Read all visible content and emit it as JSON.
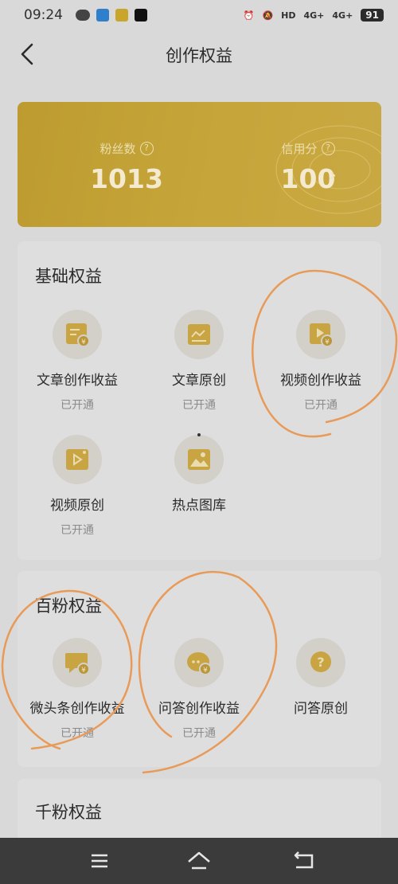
{
  "status_bar": {
    "time": "09:24",
    "battery": "91",
    "net1": "4G+",
    "net2": "4G+",
    "hd": "HD"
  },
  "nav": {
    "title": "创作权益"
  },
  "stats": {
    "fans": {
      "label": "粉丝数",
      "value": "1013"
    },
    "credit": {
      "label": "信用分",
      "value": "100"
    }
  },
  "sections": {
    "basic": {
      "title": "基础权益",
      "items": [
        {
          "name": "文章创作收益",
          "status": "已开通",
          "icon": "article-income-icon"
        },
        {
          "name": "文章原创",
          "status": "已开通",
          "icon": "article-original-icon"
        },
        {
          "name": "视频创作收益",
          "status": "已开通",
          "icon": "video-income-icon"
        },
        {
          "name": "视频原创",
          "status": "已开通",
          "icon": "video-original-icon"
        },
        {
          "name": "热点图库",
          "status": "",
          "icon": "hot-gallery-icon"
        }
      ]
    },
    "hundred": {
      "title": "百粉权益",
      "items": [
        {
          "name": "微头条创作收益",
          "status": "已开通",
          "icon": "micro-headline-icon"
        },
        {
          "name": "问答创作收益",
          "status": "已开通",
          "icon": "qa-income-icon"
        },
        {
          "name": "问答原创",
          "status": "",
          "icon": "qa-original-icon"
        }
      ]
    },
    "thousand": {
      "title": "千粉权益"
    }
  },
  "colors": {
    "gold": "#c5a43a",
    "icon_gold": "#c9a443",
    "annotation": "#e89a58",
    "bottom_bar": "#3b3b3b"
  }
}
